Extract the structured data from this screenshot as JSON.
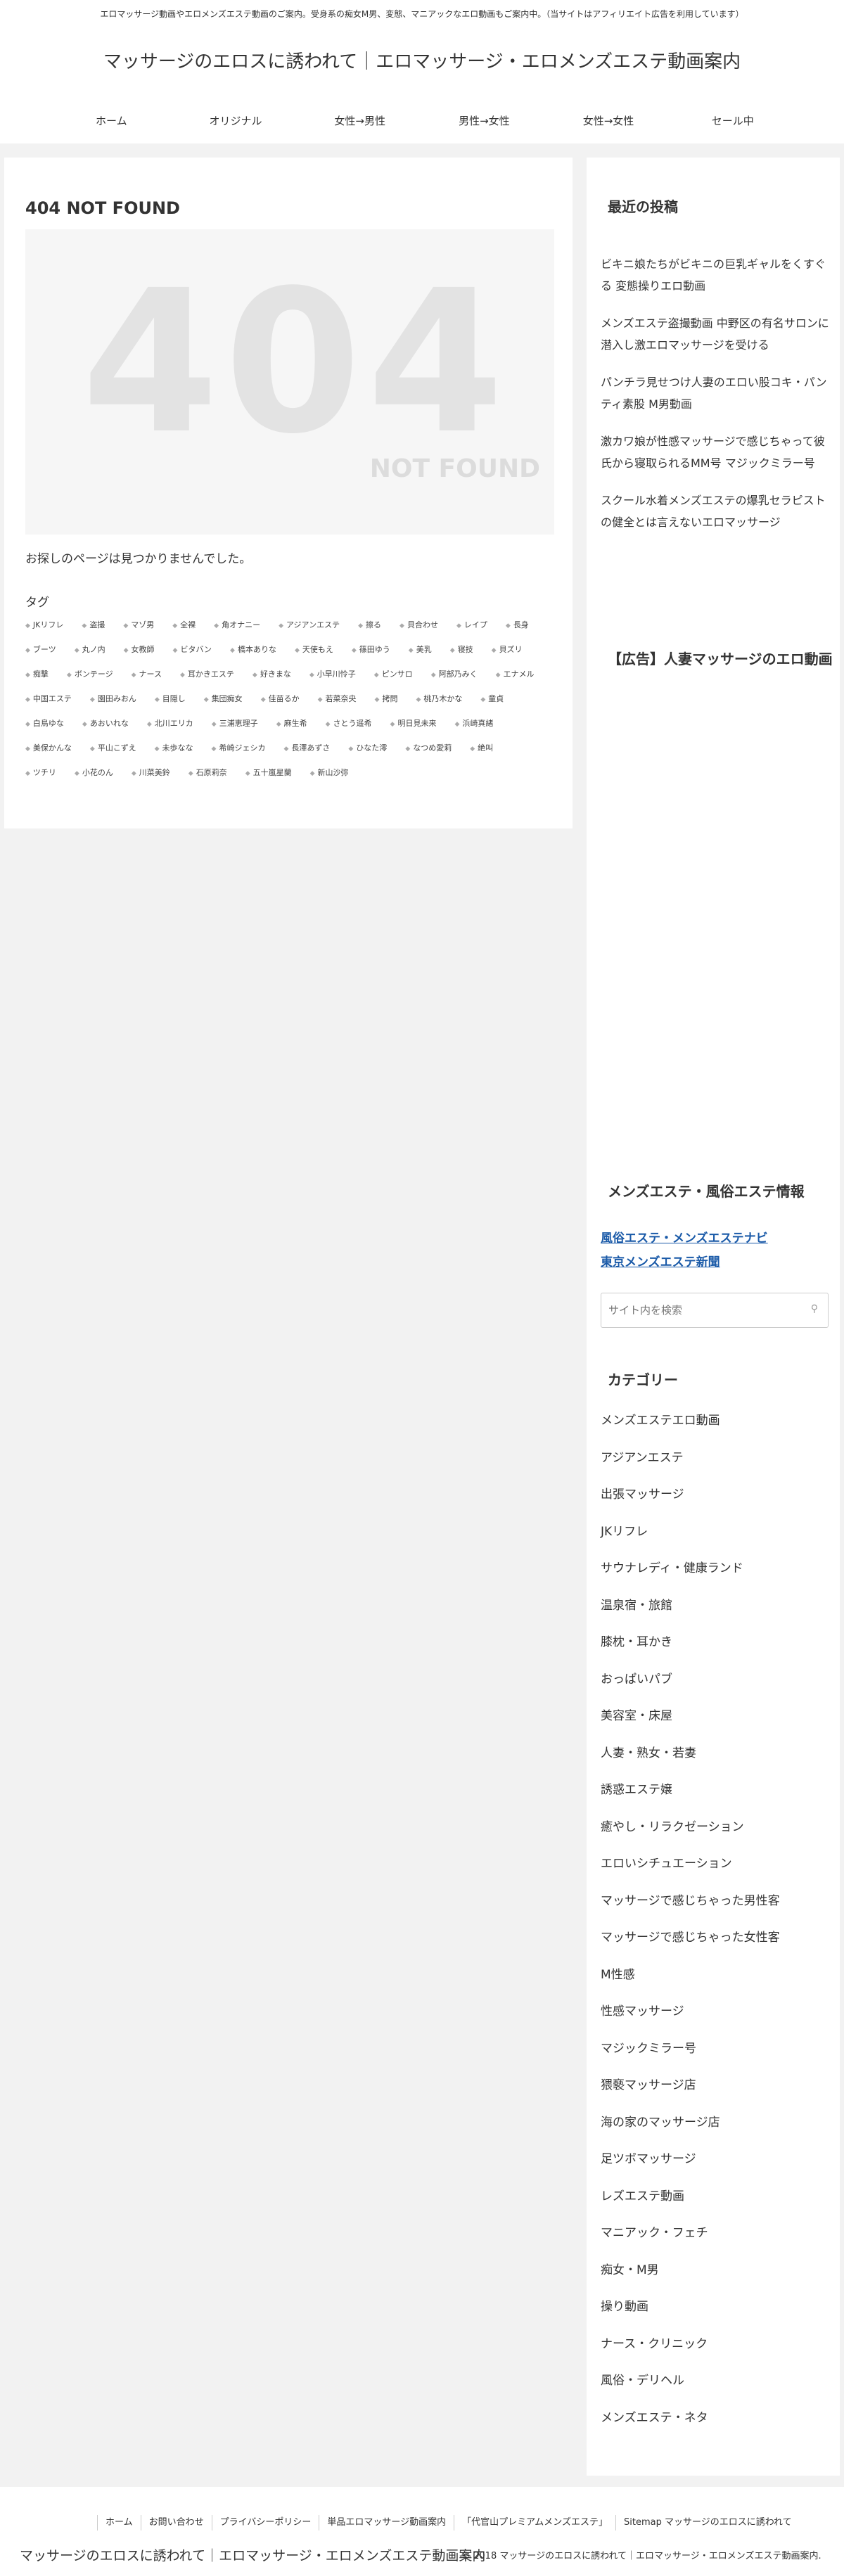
{
  "header": {
    "notice": "エロマッサージ動画やエロメンズエステ動画のご案内。受身系の痴女M男、変態、マニアックなエロ動画もご案内中。（当サイトはアフィリエイト広告を利用しています）",
    "site_title": "マッサージのエロスに誘われて｜エロマッサージ・エロメンズエステ動画案内",
    "nav": [
      "ホーム",
      "オリジナル",
      "女性→男性",
      "男性→女性",
      "女性→女性",
      "セール中"
    ]
  },
  "main": {
    "heading": "404 NOT FOUND",
    "image_number": "404",
    "image_text": "NOT FOUND",
    "message": "お探しのページは見つかりませんでした。",
    "tag_heading": "タグ",
    "tags": [
      "JKリフレ",
      "盗撮",
      "マゾ男",
      "全裸",
      "角オナニー",
      "アジアンエステ",
      "擦る",
      "貝合わせ",
      "レイプ",
      "長身",
      "ブーツ",
      "丸ノ内",
      "女教師",
      "ビタバン",
      "橋本ありな",
      "天使もえ",
      "篠田ゆう",
      "美乳",
      "寝技",
      "貝ズリ",
      "痴撃",
      "ボンテージ",
      "ナース",
      "耳かきエステ",
      "好きまな",
      "小早川怜子",
      "ピンサロ",
      "阿部乃みく",
      "エナメル",
      "中国エステ",
      "園田みおん",
      "目隠し",
      "集団痴女",
      "佳苗るか",
      "若菜奈央",
      "拷問",
      "桃乃木かな",
      "童貞",
      "白鳥ゆな",
      "あおいれな",
      "北川エリカ",
      "三浦恵理子",
      "麻生希",
      "さとう遥希",
      "明日見未来",
      "浜崎真緒",
      "美保かんな",
      "平山こずえ",
      "未歩なな",
      "希崎ジェシカ",
      "長澤あずさ",
      "ひなた澪",
      "なつめ愛莉",
      "絶叫",
      "ツチリ",
      "小花のん",
      "川菜美鈴",
      "石原莉奈",
      "五十嵐星蘭",
      "新山沙弥"
    ]
  },
  "sidebar": {
    "recent_title": "最近の投稿",
    "recent_posts": [
      "ビキニ娘たちがビキニの巨乳ギャルをくすぐる 変態操りエロ動画",
      "メンズエステ盗撮動画 中野区の有名サロンに潜入し激エロマッサージを受ける",
      "パンチラ見せつけ人妻のエロい股コキ・パンティ素股 M男動画",
      "激カワ娘が性感マッサージで感じちゃって彼氏から寝取られるMM号 マジックミラー号",
      "スクール水着メンズエステの爆乳セラピストの健全とは言えないエロマッサージ"
    ],
    "ad_title": "【広告】人妻マッサージのエロ動画",
    "info_title": "メンズエステ・風俗エステ情報",
    "info_links": [
      "風俗エステ・メンズエステナビ",
      "東京メンズエステ新聞"
    ],
    "search_placeholder": "サイト内を検索",
    "category_title": "カテゴリー",
    "categories": [
      "メンズエステエロ動画",
      "アジアンエステ",
      "出張マッサージ",
      "JKリフレ",
      "サウナレディ・健康ランド",
      "温泉宿・旅館",
      "膝枕・耳かき",
      "おっぱいパブ",
      "美容室・床屋",
      "人妻・熟女・若妻",
      "誘惑エステ嬢",
      "癒やし・リラクゼーション",
      "エロいシチュエーション",
      "マッサージで感じちゃった男性客",
      "マッサージで感じちゃった女性客",
      "M性感",
      "性感マッサージ",
      "マジックミラー号",
      "猥褻マッサージ店",
      "海の家のマッサージ店",
      "足ツボマッサージ",
      "レズエステ動画",
      "マニアック・フェチ",
      "痴女・M男",
      "操り動画",
      "ナース・クリニック",
      "風俗・デリヘル",
      "メンズエステ・ネタ"
    ]
  },
  "footer": {
    "nav": [
      "ホーム",
      "お問い合わせ",
      "プライバシーポリシー",
      "単品エロマッサージ動画案内",
      "「代官山プレミアムメンズエステ」",
      "Sitemap マッサージのエロスに誘われて"
    ],
    "title": "マッサージのエロスに誘われて｜エロマッサージ・エロメンズエステ動画案内",
    "copyright": "© 2018 マッサージのエロスに誘われて｜エロマッサージ・エロメンズエステ動画案内."
  },
  "icons": {
    "tag": "tag-icon",
    "search": "search-icon"
  }
}
